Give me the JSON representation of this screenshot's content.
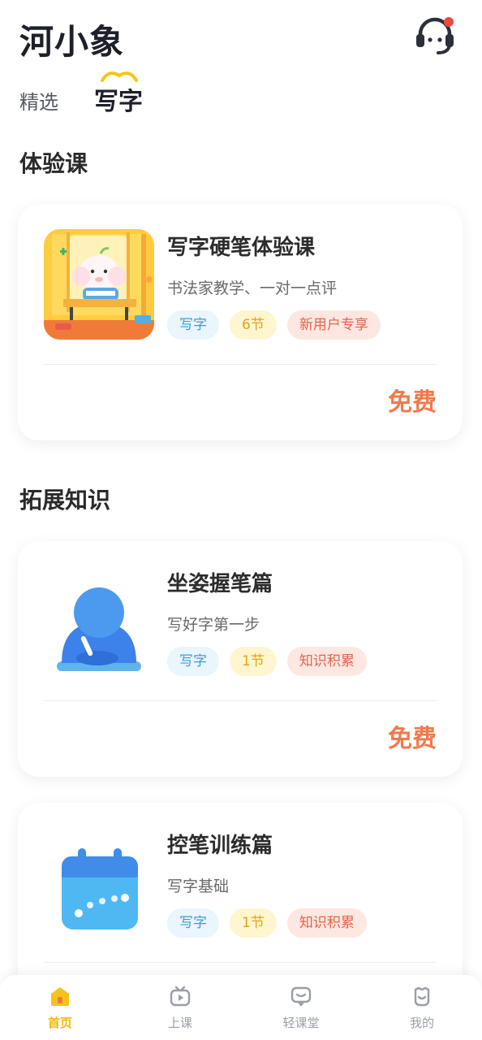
{
  "header": {
    "app_title": "河小象",
    "support_icon": "headset-icon"
  },
  "tabs": [
    {
      "label": "精选",
      "active": false
    },
    {
      "label": "写字",
      "active": true
    }
  ],
  "sections": {
    "trial": {
      "title": "体验课"
    },
    "extended": {
      "title": "拓展知识"
    }
  },
  "courses": [
    {
      "title": "写字硬笔体验课",
      "subtitle": "书法家教学、一对一点评",
      "tags": [
        "写字",
        "6节",
        "新用户专享"
      ],
      "price": "免费",
      "thumb": "elephant-writing-illustration"
    },
    {
      "title": "坐姿握笔篇",
      "subtitle": "写好字第一步",
      "tags": [
        "写字",
        "1节",
        "知识积累"
      ],
      "price": "免费",
      "thumb": "sitting-posture-icon"
    },
    {
      "title": "控笔训练篇",
      "subtitle": "写字基础",
      "tags": [
        "写字",
        "1节",
        "知识积累"
      ],
      "price": "",
      "thumb": "calendar-icon"
    }
  ],
  "bottom_nav": [
    {
      "label": "首页",
      "icon": "home-icon",
      "active": true
    },
    {
      "label": "上课",
      "icon": "tv-play-icon",
      "active": false
    },
    {
      "label": "轻课堂",
      "icon": "chat-bubble-icon",
      "active": false
    },
    {
      "label": "我的",
      "icon": "profile-icon",
      "active": false
    }
  ],
  "colors": {
    "accent": "#f5b800",
    "price": "#f2794c",
    "tag_blue": "#3b9fd6",
    "tag_yellow": "#e3a415",
    "tag_red": "#e0664a"
  }
}
